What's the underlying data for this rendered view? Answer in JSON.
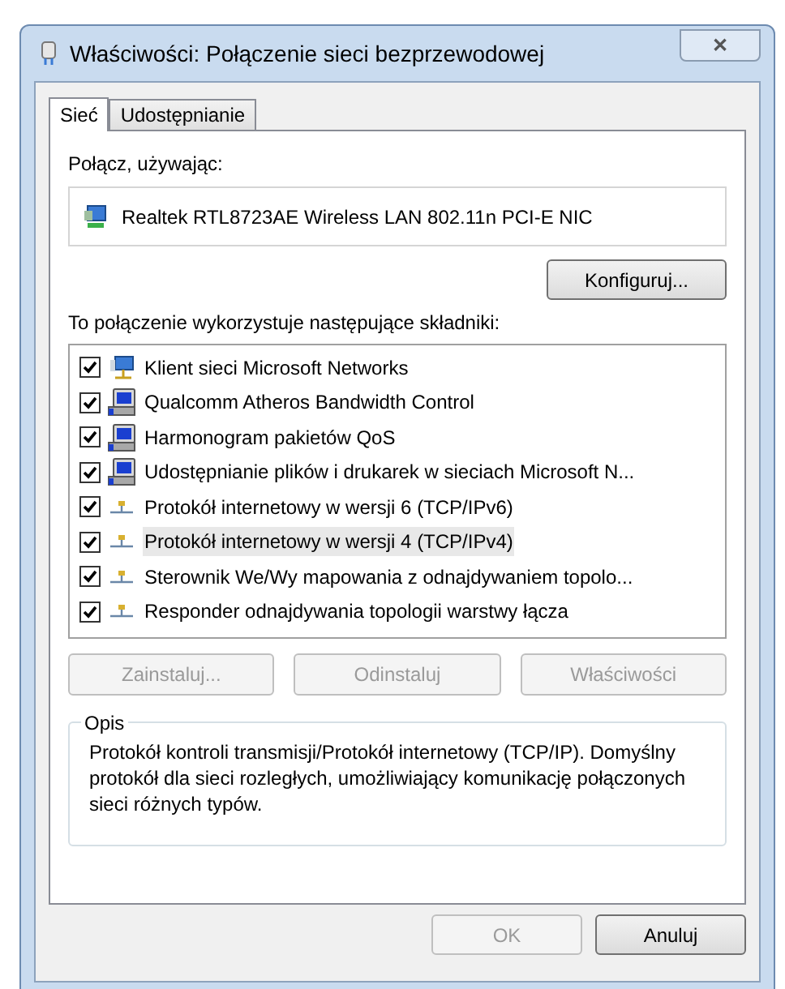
{
  "window": {
    "title": "Właściwości: Połączenie sieci bezprzewodowej",
    "close": "✕"
  },
  "tabs": [
    {
      "label": "Sieć",
      "selected": true
    },
    {
      "label": "Udostępnianie",
      "selected": false
    }
  ],
  "connect_using": {
    "label": "Połącz, używając:",
    "adapter": "Realtek RTL8723AE Wireless LAN 802.11n PCI-E NIC",
    "configure_button": "Konfiguruj..."
  },
  "components": {
    "label": "To połączenie wykorzystuje następujące składniki:",
    "items": [
      {
        "kind": "client",
        "name": "Klient sieci Microsoft Networks",
        "checked": true,
        "selected": false
      },
      {
        "kind": "service",
        "name": "Qualcomm Atheros Bandwidth Control",
        "checked": true,
        "selected": false
      },
      {
        "kind": "service",
        "name": "Harmonogram pakietów QoS",
        "checked": true,
        "selected": false
      },
      {
        "kind": "service",
        "name": "Udostępnianie plików i drukarek w sieciach Microsoft N...",
        "checked": true,
        "selected": false
      },
      {
        "kind": "protocol",
        "name": "Protokół internetowy w wersji 6 (TCP/IPv6)",
        "checked": true,
        "selected": false
      },
      {
        "kind": "protocol",
        "name": "Protokół internetowy w wersji 4 (TCP/IPv4)",
        "checked": true,
        "selected": true
      },
      {
        "kind": "protocol",
        "name": "Sterownik We/Wy mapowania z odnajdywaniem topolo...",
        "checked": true,
        "selected": false
      },
      {
        "kind": "protocol",
        "name": "Responder odnajdywania topologii warstwy łącza",
        "checked": true,
        "selected": false
      }
    ]
  },
  "component_buttons": [
    {
      "label": "Zainstaluj...",
      "disabled": true
    },
    {
      "label": "Odinstaluj",
      "disabled": true
    },
    {
      "label": "Właściwości",
      "disabled": true
    }
  ],
  "description": {
    "title": "Opis",
    "text": "Protokół kontroli transmisji/Protokół internetowy (TCP/IP). Domyślny protokół dla sieci rozległych, umożliwiający komunikację połączonych sieci różnych typów."
  },
  "dialog_buttons": [
    {
      "label": "OK",
      "disabled": true
    },
    {
      "label": "Anuluj",
      "disabled": false
    }
  ]
}
